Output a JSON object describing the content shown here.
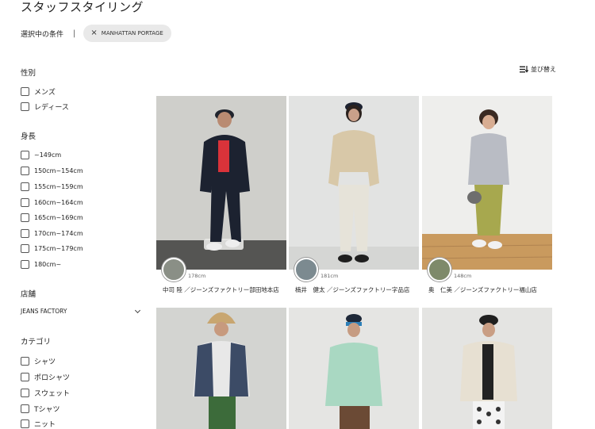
{
  "header": {
    "title": "スタッフスタイリング"
  },
  "conditions": {
    "label": "選択中の条件",
    "separator": "|",
    "chip_label": "MANHATTAN PORTAGE",
    "chip_remove": "×"
  },
  "sort": {
    "label": "並び替え",
    "icon": "sort-icon"
  },
  "filters": {
    "gender": {
      "title": "性別",
      "items": [
        "メンズ",
        "レディース"
      ]
    },
    "height": {
      "title": "身長",
      "items": [
        "~149cm",
        "150cm~154cm",
        "155cm~159cm",
        "160cm~164cm",
        "165cm~169cm",
        "170cm~174cm",
        "175cm~179cm",
        "180cm~"
      ]
    },
    "store": {
      "title": "店舗",
      "selected": "JEANS FACTORY"
    },
    "category": {
      "title": "カテゴリ",
      "items": [
        "シャツ",
        "ポロシャツ",
        "スウェット",
        "Tシャツ",
        "ニット"
      ]
    }
  },
  "cards": [
    {
      "height": "178cm",
      "caption": "中司 陸 ／ジーンズファクトリー部田地本店"
    },
    {
      "height": "181cm",
      "caption": "楠井　健太 ／ジーンズファクトリー字品店"
    },
    {
      "height": "148cm",
      "caption": "奥　仁美 ／ジーンズファクトリー福山店"
    },
    {
      "height": "",
      "caption": ""
    },
    {
      "height": "",
      "caption": ""
    },
    {
      "height": "",
      "caption": ""
    }
  ],
  "colors": {
    "chip_bg": "#e9e9e9",
    "photo_wall_1": "#cfcfcb",
    "photo_wall_2": "#e2e3e2",
    "photo_wall_3": "#eeeeec",
    "floor_wood": "#c99a5e",
    "floor_concrete": "#555553"
  }
}
